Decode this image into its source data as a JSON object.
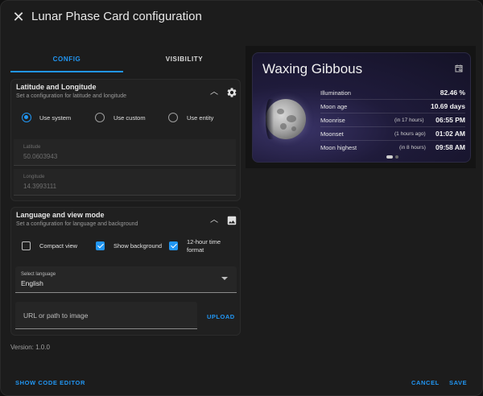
{
  "header": {
    "title": "Lunar Phase Card configuration",
    "close_icon": "close-icon"
  },
  "tabs": [
    {
      "label": "CONFIG",
      "active": true
    },
    {
      "label": "VISIBILITY",
      "active": false
    }
  ],
  "location_panel": {
    "title": "Latitude and Longitude",
    "subtitle": "Set a configuration for latitude and longitude",
    "radios": [
      {
        "label": "Use system",
        "checked": true
      },
      {
        "label": "Use custom",
        "checked": false
      },
      {
        "label": "Use entity",
        "checked": false
      }
    ],
    "latitude": {
      "label": "Latitude",
      "value": "50.0603943"
    },
    "longitude": {
      "label": "Longitude",
      "value": "14.3993111"
    }
  },
  "language_panel": {
    "title": "Language and view mode",
    "subtitle": "Set a configuration for language and background",
    "checkboxes": [
      {
        "label": "Compact view",
        "checked": false
      },
      {
        "label": "Show background",
        "checked": true
      },
      {
        "label_line1": "12-hour time",
        "label_line2": "format",
        "checked": true
      }
    ],
    "select": {
      "label": "Select language",
      "value": "English"
    },
    "url": {
      "placeholder": "URL or path to image"
    },
    "upload_label": "UPLOAD"
  },
  "version": "Version: 1.0.0",
  "footer": {
    "code_editor": "SHOW CODE EDITOR",
    "cancel": "CANCEL",
    "save": "SAVE"
  },
  "preview": {
    "phase": "Waxing Gibbous",
    "rows": [
      {
        "label": "Illumination",
        "note": "",
        "value": "82.46 %"
      },
      {
        "label": "Moon age",
        "note": "",
        "value": "10.69 days"
      },
      {
        "label": "Moonrise",
        "note": "(in 17 hours)",
        "value": "06:55 PM"
      },
      {
        "label": "Moonset",
        "note": "(1 hours ago)",
        "value": "01:02 AM"
      },
      {
        "label": "Moon highest",
        "note": "(in 8 hours)",
        "value": "09:58 AM"
      }
    ]
  },
  "colors": {
    "accent": "#2196f3",
    "background": "#1c1c1c"
  }
}
